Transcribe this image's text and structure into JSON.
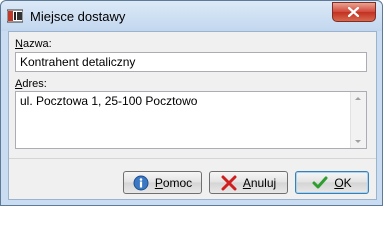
{
  "window": {
    "title": "Miejsce dostawy"
  },
  "form": {
    "name_label_mnemonic": "N",
    "name_label_rest": "azwa:",
    "name_value": "Kontrahent detaliczny",
    "address_label_mnemonic": "A",
    "address_label_rest": "dres:",
    "address_value": "ul. Pocztowa 1, 25-100 Pocztowo"
  },
  "buttons": {
    "help_mnemonic": "P",
    "help_rest": "omoc",
    "cancel_mnemonic": "A",
    "cancel_rest": "nuluj",
    "ok_mnemonic": "O",
    "ok_rest": "K"
  },
  "icons": {
    "app": "app-icon",
    "close": "close-icon",
    "help": "info-icon",
    "cancel": "cross-icon",
    "ok": "checkmark-icon"
  }
}
